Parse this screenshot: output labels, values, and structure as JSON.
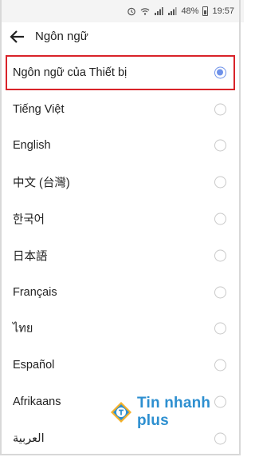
{
  "statusbar": {
    "battery": "48%",
    "time": "19:57"
  },
  "appbar": {
    "title": "Ngôn ngữ"
  },
  "languages": [
    {
      "label": "Ngôn ngữ của Thiết bị",
      "selected": true
    },
    {
      "label": "Tiếng Việt",
      "selected": false
    },
    {
      "label": "English",
      "selected": false
    },
    {
      "label": "中文 (台灣)",
      "selected": false
    },
    {
      "label": "한국어",
      "selected": false
    },
    {
      "label": "日本語",
      "selected": false
    },
    {
      "label": "Français",
      "selected": false
    },
    {
      "label": "ไทย",
      "selected": false
    },
    {
      "label": "Español",
      "selected": false
    },
    {
      "label": "Afrikaans",
      "selected": false
    },
    {
      "label": "العربية",
      "selected": false
    }
  ],
  "colors": {
    "accent": "#6f92e9",
    "highlight_border": "#d9232a",
    "watermark": "#2d8fd0"
  },
  "watermark": {
    "text": "Tin nhanh plus"
  }
}
